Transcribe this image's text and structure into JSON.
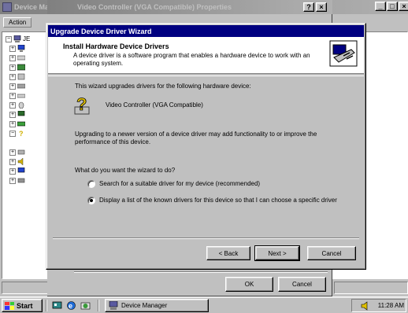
{
  "device_manager": {
    "title": "Device Manag",
    "menu_action": "Action",
    "tree_root": "JE"
  },
  "properties": {
    "title": "Video Controller (VGA Compatible) Properties",
    "help_label": "?",
    "close_label": "×",
    "ok_label": "OK",
    "cancel_label": "Cancel"
  },
  "wizard": {
    "title": "Upgrade Device Driver Wizard",
    "header_title": "Install Hardware Device Drivers",
    "header_subtitle": "A device driver is a software program that enables a hardware device to work with an operating system.",
    "intro": "This wizard upgrades drivers for the following hardware device:",
    "device_name": "Video Controller (VGA Compatible)",
    "upgrade_text": "Upgrading to a newer version of a device driver may add functionality to or improve the performance of this device.",
    "question": "What do you want the wizard to do?",
    "option_search": "Search for a suitable driver for my device (recommended)",
    "option_list": "Display a list of the known drivers for this device so that I can choose a specific driver",
    "back_label": "< Back",
    "next_label": "Next >",
    "cancel_label": "Cancel",
    "selected_option": "list"
  },
  "taskbar": {
    "start_label": "Start",
    "task_device_manager": "Device Manager",
    "clock": "11:28 AM"
  },
  "window_controls": {
    "minimize": "_",
    "maximize": "□",
    "close": "×"
  }
}
